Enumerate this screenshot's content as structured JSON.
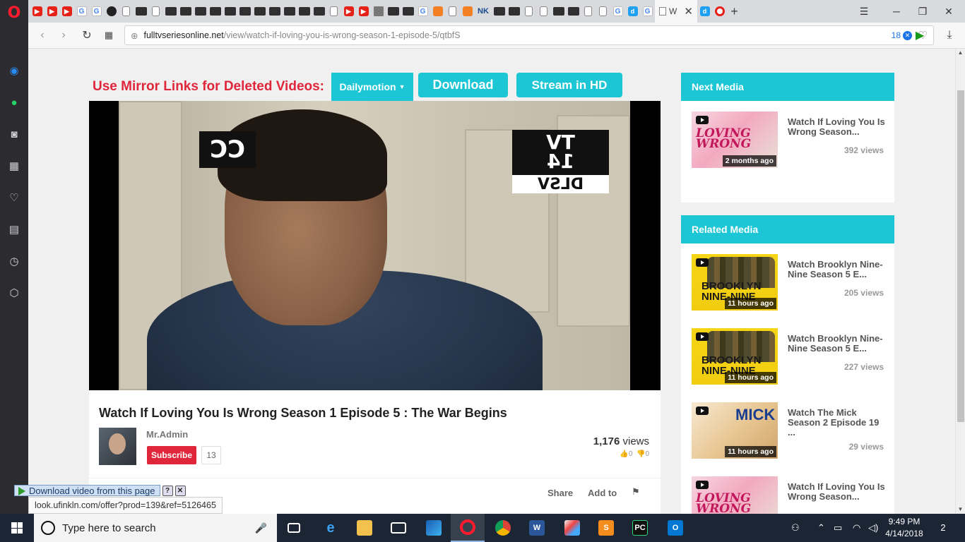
{
  "browser": {
    "active_tab_title": "W",
    "url_host": "fulltvseriesonline.net",
    "url_path": "/view/watch-if-loving-you-is-wrong-season-1-episode-5/qtbfS",
    "blocked_count": "18"
  },
  "page": {
    "mirror_text": "Use Mirror Links for Deleted Videos:",
    "mirror_select": "Dailymotion",
    "download_label": "Download",
    "stream_label": "Stream in HD",
    "video_overlay_cc": "CC",
    "video_overlay_rating": [
      "TV",
      "14"
    ],
    "video_overlay_dlsv": "DLSV",
    "video_title": "Watch If Loving You Is Wrong Season 1 Episode 5 : The War Begins",
    "uploader": "Mr.Admin",
    "subscribe_label": "Subscribe",
    "subscriber_count": "13",
    "views_count": "1,176",
    "views_label": "views",
    "likes": "0",
    "dislikes": "0",
    "share_label": "Share",
    "add_to_label": "Add to"
  },
  "sidebar_right": {
    "next_media_title": "Next Media",
    "next_media": [
      {
        "title": "Watch If Loving You Is Wrong Season...",
        "views": "392 views",
        "ago": "2 months ago",
        "thumb_text": "LOVING WRONG"
      }
    ],
    "related_media_title": "Related Media",
    "related_media": [
      {
        "title": "Watch Brooklyn Nine-Nine Season 5 E...",
        "views": "205 views",
        "ago": "11 hours ago",
        "thumb_text": "BROOKLYN NINE-NINE"
      },
      {
        "title": "Watch Brooklyn Nine-Nine Season 5 E...",
        "views": "227 views",
        "ago": "11 hours ago",
        "thumb_text": "BROOKLYN NINE-NINE"
      },
      {
        "title": "Watch The Mick Season 2 Episode 19 ...",
        "views": "29 views",
        "ago": "11 hours ago",
        "thumb_text": "MICK"
      },
      {
        "title": "Watch If Loving You Is Wrong Season...",
        "views": "",
        "ago": "",
        "thumb_text": "LOVING WRONG"
      }
    ]
  },
  "overlay": {
    "download_popup": "Download video from this page",
    "status_url": "look.ufinkln.com/offer?prod=139&ref=5126465"
  },
  "taskbar": {
    "search_placeholder": "Type here to search",
    "time": "9:49 PM",
    "date": "4/14/2018",
    "notifications": "2"
  }
}
